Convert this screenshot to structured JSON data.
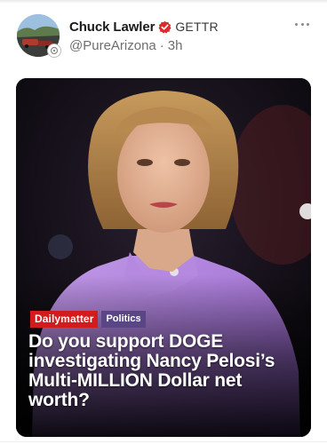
{
  "post": {
    "author_name": "Chuck Lawler",
    "platform_badge": "GETTR",
    "handle": "@PureArizona",
    "separator": "·",
    "time_ago": "3h",
    "icons": {
      "verified": "verified-badge-icon",
      "more": "more-options-icon",
      "avatar": "avatar"
    },
    "colors": {
      "verified_red": "#e0282d",
      "handle_gray": "#6e6e6e"
    }
  },
  "media": {
    "tag_brand": "Dailymatter",
    "tag_category": "Politics",
    "headline": "Do you support DOGE investigating Nancy Pelosi’s Multi-MILLION Dollar net worth?",
    "colors": {
      "tag_brand_bg": "#d41b1b",
      "tag_category_bg": "#5a4687",
      "jacket": "#b48ae0"
    }
  }
}
